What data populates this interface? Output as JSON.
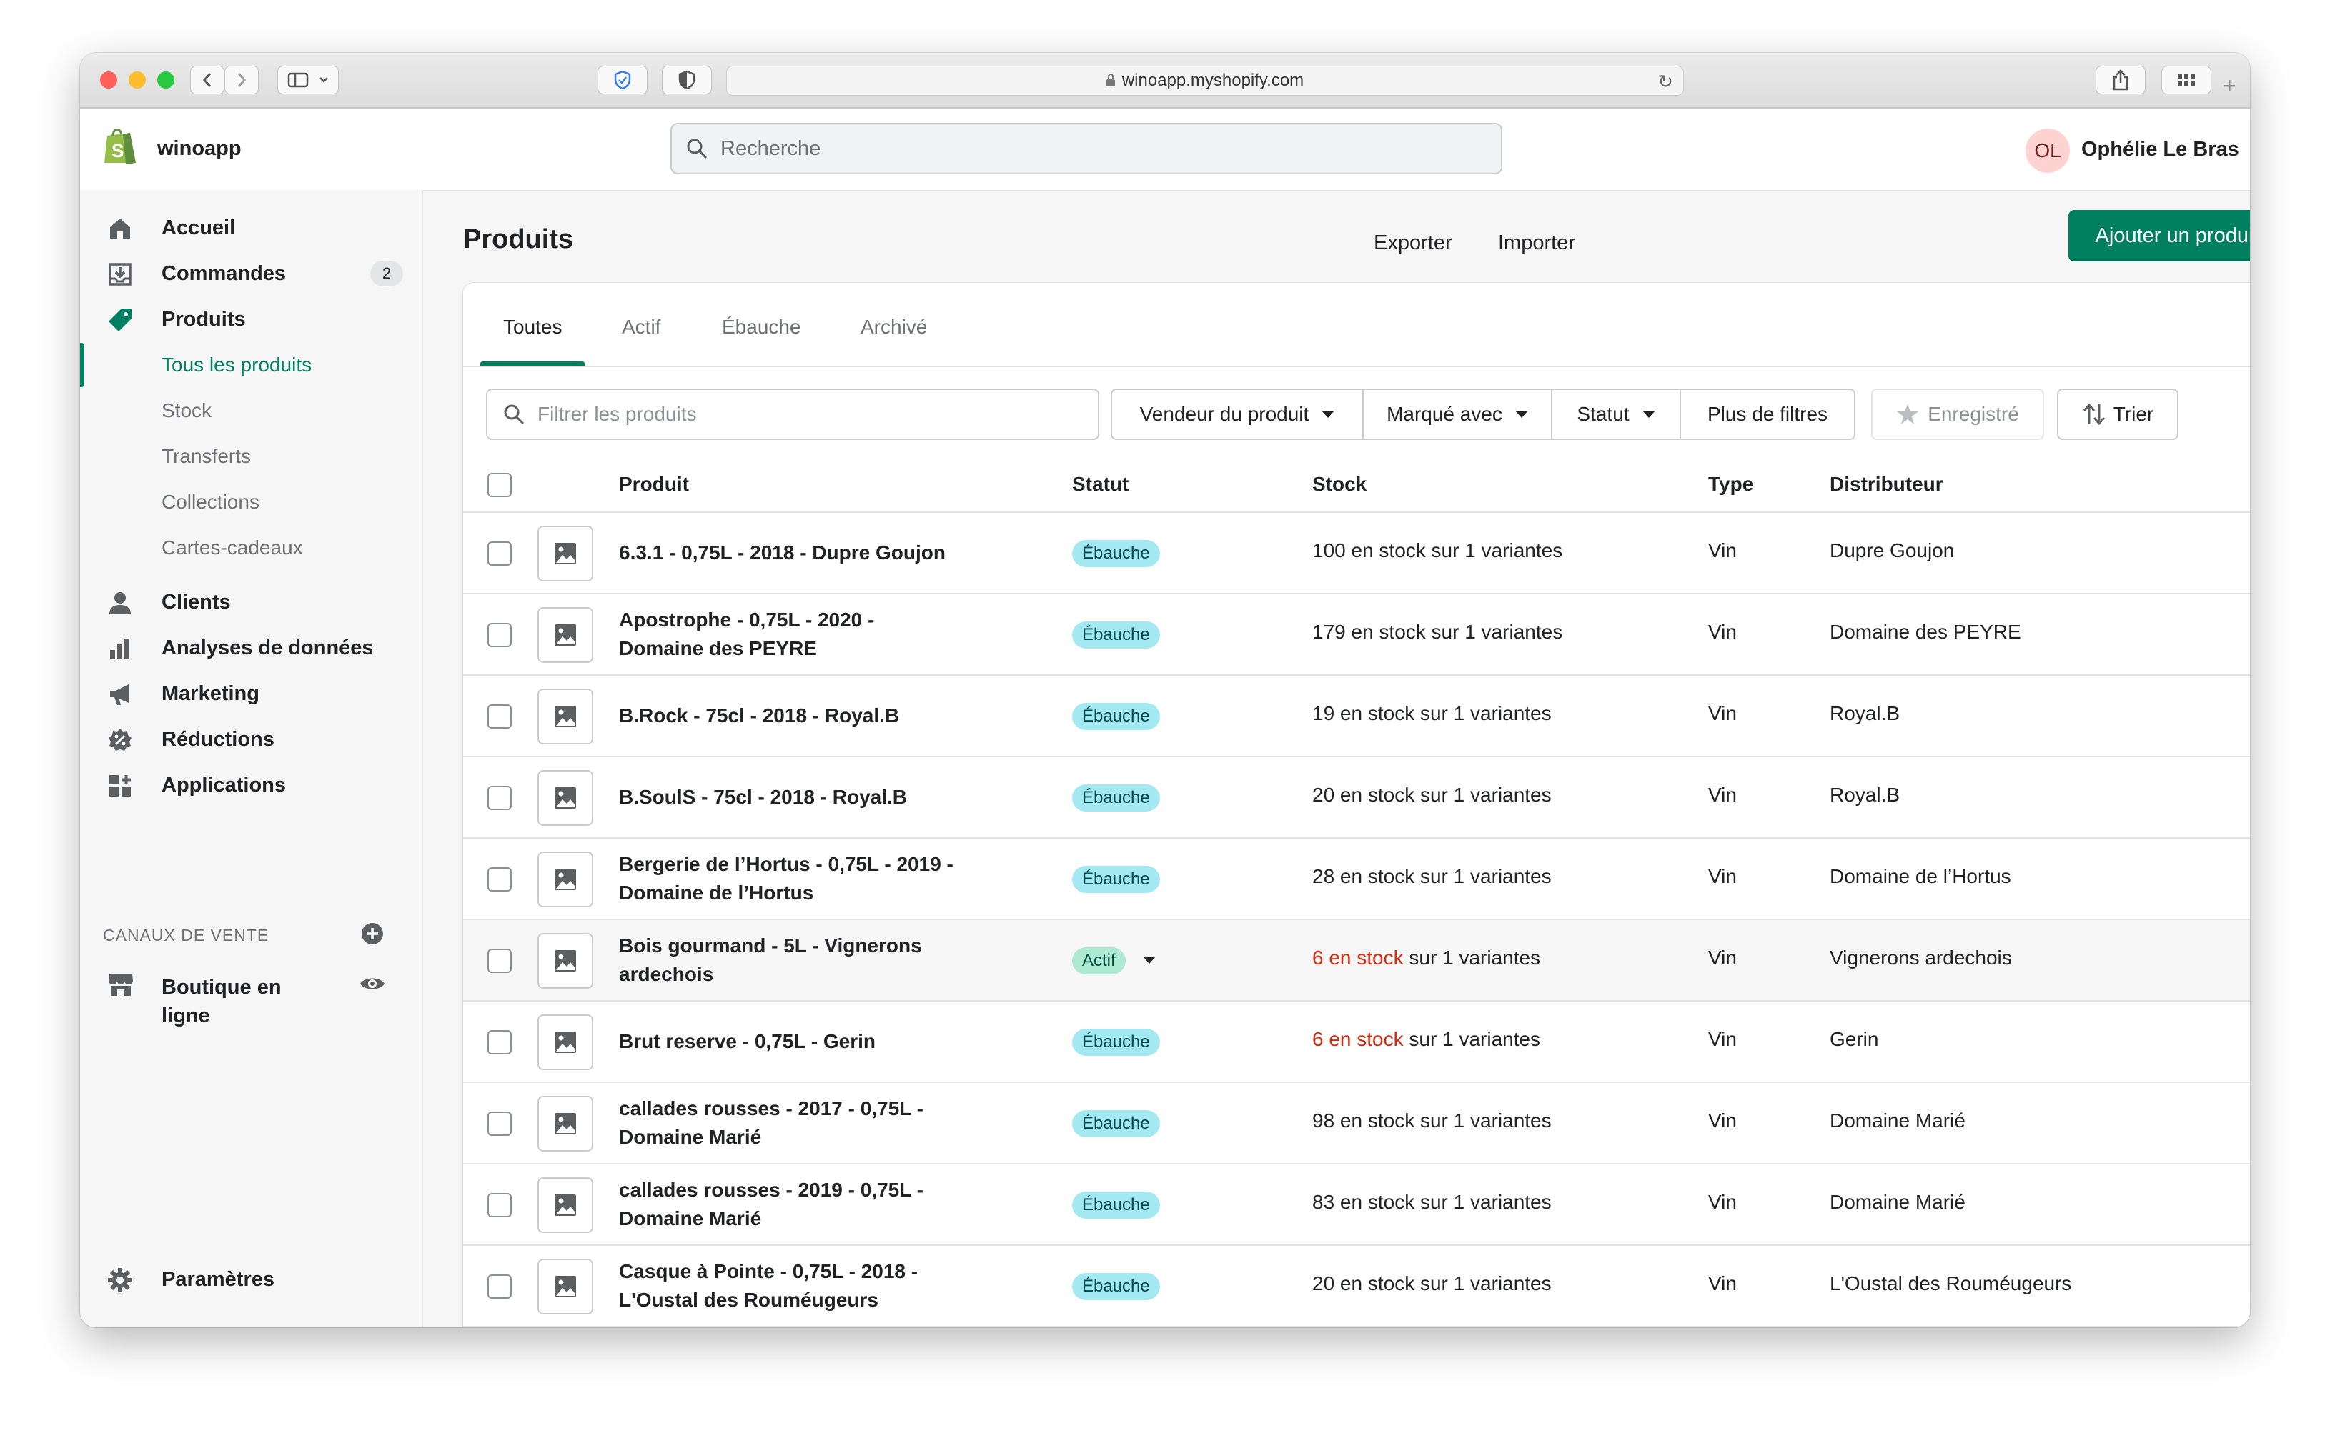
{
  "browser": {
    "url": "winoapp.myshopify.com"
  },
  "topbar": {
    "store_name": "winoapp",
    "search_placeholder": "Recherche",
    "avatar_initials": "OL",
    "user_name": "Ophélie Le Bras"
  },
  "sidebar": {
    "items": [
      {
        "label": "Accueil",
        "icon": "home-icon"
      },
      {
        "label": "Commandes",
        "icon": "orders-icon",
        "badge": "2"
      },
      {
        "label": "Produits",
        "icon": "tag-icon"
      }
    ],
    "product_subitems": [
      {
        "label": "Tous les produits",
        "active": true
      },
      {
        "label": "Stock"
      },
      {
        "label": "Transferts"
      },
      {
        "label": "Collections"
      },
      {
        "label": "Cartes-cadeaux"
      }
    ],
    "items_after": [
      {
        "label": "Clients",
        "icon": "person-icon"
      },
      {
        "label": "Analyses de données",
        "icon": "bar-chart-icon"
      },
      {
        "label": "Marketing",
        "icon": "megaphone-icon"
      },
      {
        "label": "Réductions",
        "icon": "discount-icon"
      },
      {
        "label": "Applications",
        "icon": "apps-icon"
      }
    ],
    "sales_channels_title": "CANAUX DE VENTE",
    "channel": {
      "label_line1": "Boutique en",
      "label_line2": "ligne",
      "icon": "store-icon"
    },
    "settings_label": "Paramètres"
  },
  "page": {
    "title": "Produits",
    "export_label": "Exporter",
    "import_label": "Importer",
    "add_product_label": "Ajouter un produit"
  },
  "tabs": [
    "Toutes",
    "Actif",
    "Ébauche",
    "Archivé"
  ],
  "filters": {
    "search_placeholder": "Filtrer les produits",
    "vendor_label": "Vendeur du produit",
    "tagged_label": "Marqué avec",
    "status_label": "Statut",
    "more_filters_label": "Plus de filtres",
    "saved_label": "Enregistré",
    "sort_label": "Trier"
  },
  "table": {
    "headers": {
      "product": "Produit",
      "status": "Statut",
      "stock": "Stock",
      "type": "Type",
      "vendor": "Distributeur"
    },
    "rows": [
      {
        "line1": "6.3.1 - 0,75L - 2018 - Dupre Goujon",
        "line2": "",
        "status": "Ébauche",
        "stock_qty": "100 en stock",
        "stock_rest": " sur 1 variantes",
        "low": false,
        "type": "Vin",
        "vendor": "Dupre Goujon"
      },
      {
        "line1": "Apostrophe - 0,75L - 2020 -",
        "line2": "Domaine des PEYRE",
        "status": "Ébauche",
        "stock_qty": "179 en stock",
        "stock_rest": " sur 1 variantes",
        "low": false,
        "type": "Vin",
        "vendor": "Domaine des PEYRE"
      },
      {
        "line1": "B.Rock - 75cl - 2018 - Royal.B",
        "line2": "",
        "status": "Ébauche",
        "stock_qty": "19 en stock",
        "stock_rest": " sur 1 variantes",
        "low": false,
        "type": "Vin",
        "vendor": "Royal.B"
      },
      {
        "line1": "B.SoulS - 75cl - 2018 - Royal.B",
        "line2": "",
        "status": "Ébauche",
        "stock_qty": "20 en stock",
        "stock_rest": " sur 1 variantes",
        "low": false,
        "type": "Vin",
        "vendor": "Royal.B"
      },
      {
        "line1": "Bergerie de l’Hortus - 0,75L - 2019 -",
        "line2": "Domaine de l’Hortus",
        "status": "Ébauche",
        "stock_qty": "28 en stock",
        "stock_rest": " sur 1 variantes",
        "low": false,
        "type": "Vin",
        "vendor": "Domaine de l’Hortus"
      },
      {
        "line1": "Bois gourmand - 5L - Vignerons",
        "line2": "ardechois",
        "status": "Actif",
        "stock_qty": "6 en stock",
        "stock_rest": " sur 1 variantes",
        "low": true,
        "type": "Vin",
        "vendor": "Vignerons ardechois",
        "hover": true
      },
      {
        "line1": "Brut reserve - 0,75L - Gerin",
        "line2": "",
        "status": "Ébauche",
        "stock_qty": "6 en stock",
        "stock_rest": " sur 1 variantes",
        "low": true,
        "type": "Vin",
        "vendor": "Gerin"
      },
      {
        "line1": "callades rousses - 2017 - 0,75L -",
        "line2": "Domaine Marié",
        "status": "Ébauche",
        "stock_qty": "98 en stock",
        "stock_rest": " sur 1 variantes",
        "low": false,
        "type": "Vin",
        "vendor": "Domaine Marié"
      },
      {
        "line1": "callades rousses - 2019 - 0,75L -",
        "line2": "Domaine Marié",
        "status": "Ébauche",
        "stock_qty": "83 en stock",
        "stock_rest": " sur 1 variantes",
        "low": false,
        "type": "Vin",
        "vendor": "Domaine Marié"
      },
      {
        "line1": "Casque à Pointe - 0,75L - 2018 -",
        "line2": "L'Oustal des Rouméugeurs",
        "status": "Ébauche",
        "stock_qty": "20 en stock",
        "stock_rest": " sur 1 variantes",
        "low": false,
        "type": "Vin",
        "vendor": "L'Oustal des Rouméugeurs"
      }
    ]
  },
  "colors": {
    "brand_green": "#008060",
    "draft_badge": "#a4e8f2",
    "active_badge": "#aee9d1",
    "low_stock": "#d72c0d"
  }
}
